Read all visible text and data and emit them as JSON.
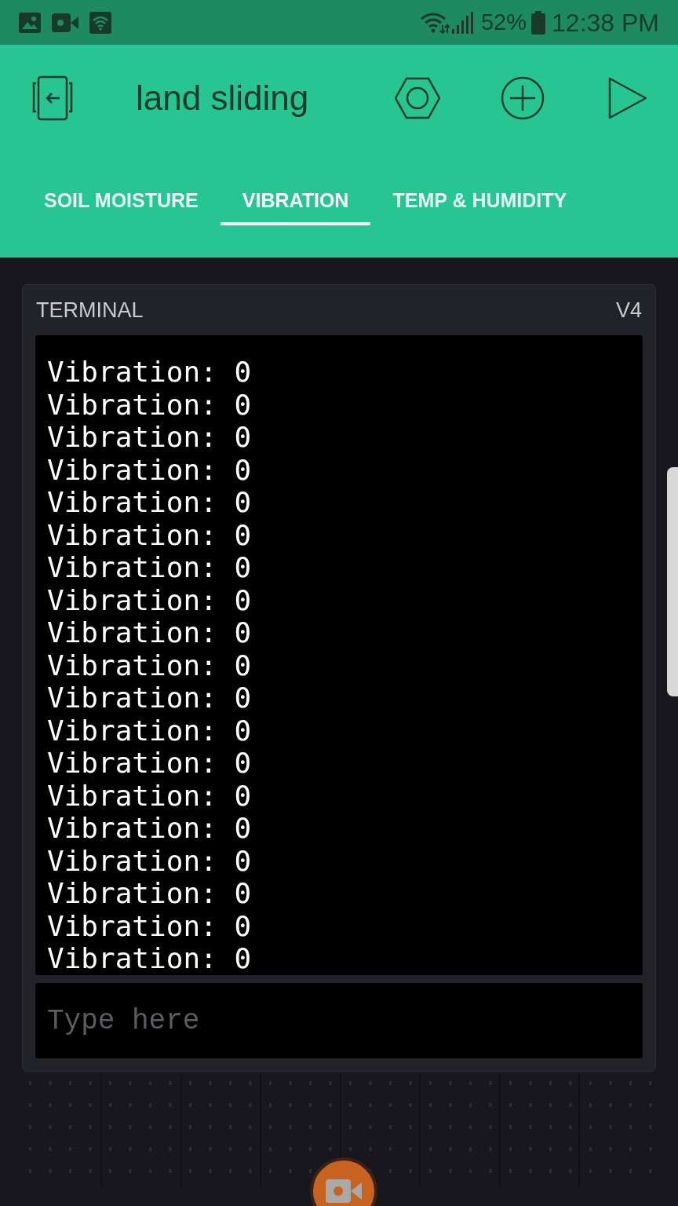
{
  "status_bar": {
    "battery": "52%",
    "time": "12:38 PM"
  },
  "header": {
    "title": "land sliding"
  },
  "tabs": [
    {
      "label": "SOIL MOISTURE",
      "selected": false
    },
    {
      "label": "VIBRATION",
      "selected": true
    },
    {
      "label": "TEMP & HUMIDITY",
      "selected": false
    }
  ],
  "terminal": {
    "title": "TERMINAL",
    "pin": "V4",
    "lines": [
      "Vibration: 0",
      "Vibration: 0",
      "Vibration: 0",
      "Vibration: 0",
      "Vibration: 0",
      "Vibration: 0",
      "Vibration: 0",
      "Vibration: 0",
      "Vibration: 0",
      "Vibration: 0",
      "Vibration: 0",
      "Vibration: 0",
      "Vibration: 0",
      "Vibration: 0",
      "Vibration: 0",
      "Vibration: 0",
      "Vibration: 0",
      "Vibration: 0",
      "Vibration: 0"
    ],
    "input": {
      "placeholder": "Type here"
    }
  }
}
